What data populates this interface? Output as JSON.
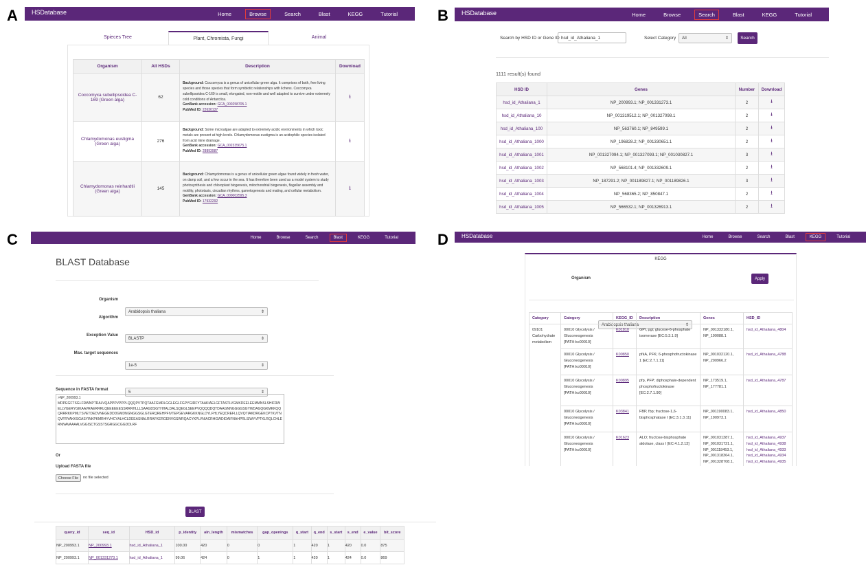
{
  "brand": "HSDatabase",
  "nav": [
    "Home",
    "Browse",
    "Search",
    "Blast",
    "KEGG",
    "Tutorial"
  ],
  "panels": {
    "a": "A",
    "b": "B",
    "c": "C",
    "d": "D"
  },
  "browse": {
    "tabs": [
      "Spieces Tree",
      "Plant, Chromista, Fungi",
      "Animal"
    ],
    "headers": [
      "Organism",
      "All HSDs",
      "Description",
      "Download"
    ],
    "labels": {
      "bg": "Background:",
      "gb": "GenBank accession:",
      "pm": "PubMed ID:"
    },
    "rows": [
      {
        "org": "Coccomyxa subellipsoidea C-169 (Green alga)",
        "n": "62",
        "bg": "Coccomyxa is a genus of unicellular green alga. It comprises of both, free living species and those species that form symbiotic relationships with lichens. Coccomyxa subellipsoidea C-169 is small, elongated, non-motile and well adapted to survive under extremely cold conditions of Antarctica.",
        "gb": "GCA_000258705.1",
        "pm": "22630137"
      },
      {
        "org": "Chlamydomonas eustigma (Green alga)",
        "n": "276",
        "bg": "Some microalgae are adapted to extremely acidic environments in which toxic metals are present at high levels. Chlamydomonas eustigma is an acidophilic species isolated from acid mine drainage.",
        "gb": "GCA_002335675.1",
        "pm": "28893987"
      },
      {
        "org": "Chlamydomonas reinhardtii (Green alga)",
        "n": "145",
        "bg": "Chlamydomonas is a genus of unicellular green algae found widely in fresh water, on damp soil, and a few occur in the sea. It has therefore been used as a model system to study photosynthesis and chloroplast biogenesis, mitochondrial biogenesis, flagellar assembly and motility, phototaxis, circadian rhythms, gametogenesis and mating, and cellular metabolism.",
        "gb": "GCA_000002595.3",
        "pm": "17932292"
      }
    ]
  },
  "search": {
    "label": "Search by HSD ID or Gene ID",
    "value": "hsd_id_Athaliana_1",
    "cat_label": "Select Category",
    "cat_value": "All",
    "button": "Search",
    "count": "1111 result(s) found",
    "headers": [
      "HSD ID",
      "Genes",
      "Number",
      "Download"
    ],
    "rows": [
      {
        "id": "hsd_id_Athaliana_1",
        "genes": "NP_200993.1; NP_001331273.1",
        "n": "2"
      },
      {
        "id": "hsd_id_Athaliana_10",
        "genes": "NP_001319512.1; NP_001327098.1",
        "n": "2"
      },
      {
        "id": "hsd_id_Athaliana_100",
        "genes": "NP_563760.1; NP_849599.1",
        "n": "2"
      },
      {
        "id": "hsd_id_Athaliana_1000",
        "genes": "NP_196828.2; NP_001330651.1",
        "n": "2"
      },
      {
        "id": "hsd_id_Athaliana_1001",
        "genes": "NP_001327094.1; NP_001327093.1; NP_001030827.1",
        "n": "3"
      },
      {
        "id": "hsd_id_Athaliana_1002",
        "genes": "NP_568101.4; NP_001332609.1",
        "n": "2"
      },
      {
        "id": "hsd_id_Athaliana_1003",
        "genes": "NP_187291.2; NP_001189827.1; NP_001189826.1",
        "n": "3"
      },
      {
        "id": "hsd_id_Athaliana_1004",
        "genes": "NP_568365.2; NP_850847.1",
        "n": "2"
      },
      {
        "id": "hsd_id_Athaliana_1005",
        "genes": "NP_566532.1; NP_001326913.1",
        "n": "2"
      }
    ]
  },
  "blast": {
    "title": "BLAST Database",
    "fields": [
      {
        "label": "Organism",
        "value": "Arabidopsis thaliana"
      },
      {
        "label": "Algorithm",
        "value": "BLASTP"
      },
      {
        "label": "Exception Value",
        "value": "1e-5"
      },
      {
        "label": "Max. target sequences",
        "value": "5"
      }
    ],
    "fasta_label": "Sequence in FASTA format",
    "fasta": ">NP_200993.1\nMDPEGFTSGLFRWNPTRALVQAPPPVPPPLQQQPVTPQTAAFGMRLGGLEGLFGPYGIRFYTAAKIAELGFTASTLVGMKDEELEEMMNSLSHIFRWELLVGERYGIKAAVRAERRRLQEEEEEESSRRRHLLLSAAGDSGTHHALDALSQEGLSEEPVQQQQDQTDAAGNNGGGGSGYWDAGQGKMKKQQQRRRKKPMLTSVETDEDVNEGEDDDGMDNGNGGSGLGTERQREHPFIVTEPGEVARGKKNGLDYLFHLYEQCREFLLQVQTIAKDRGEKCPTKVTNQVFRYAKKSGASYINKPKMRHYVHCYALHCLDEEASNALRRAFKERGENVGSWRQACYKPLVNIACRHGWDIDAIFNAHPRLSIWYVPTKLRQLCHLERNNAVAAAALVGGISCTGSSTSGRGGCGGDDLRF",
    "or": "Or",
    "upload": "Upload FASTA file",
    "choose": "Choose File",
    "nofile": "no file selected",
    "button": "BLAST",
    "headers": [
      "query_id",
      "seq_id",
      "HSD_id",
      "p_identity",
      "aln_length",
      "mismatches",
      "gap_openings",
      "q_start",
      "q_end",
      "s_start",
      "s_end",
      "e_value",
      "bit_score"
    ],
    "rows": [
      [
        "NP_200993.1",
        "NP_200993.1",
        "hsd_id_Athaliana_1",
        "100.00",
        "420",
        "0",
        "0",
        "1",
        "420",
        "1",
        "420",
        "0.0",
        "875"
      ],
      [
        "NP_200993.1",
        "NP_001331273.1",
        "hsd_id_Athaliana_1",
        "99.06",
        "424",
        "0",
        "1",
        "1",
        "420",
        "1",
        "424",
        "0.0",
        "869"
      ]
    ]
  },
  "kegg": {
    "tab": "KEGG",
    "org_label": "Organism",
    "org_value": "Arabidopsis thaliana",
    "button": "Apply",
    "headers": [
      "Category",
      "Category",
      "KEGG_ID",
      "Description",
      "Genes",
      "HSD_ID"
    ],
    "category": "09101 Carbohydrate metabolism",
    "rows": [
      {
        "cat": "00010 Glycolysis / Gluconeogenesis [PATH:ko00010]",
        "id": "K01810",
        "desc": "GPI, pgi; glucose-6-phosphate isomerase [EC:5.3.1.9]",
        "genes": "NP_001332180.1, NP_199088.1",
        "hsd": [
          "hsd_id_Athaliana_4804"
        ]
      },
      {
        "cat": "00010 Glycolysis / Gluconeogenesis [PATH:ko00010]",
        "id": "K00850",
        "desc": "pfkA, PFK; 6-phosphofructokinase 1 [EC:2.7.1.11]",
        "genes": "NP_001032120.1, NP_200966.2",
        "hsd": [
          "hsd_id_Athaliana_4788"
        ]
      },
      {
        "cat": "00010 Glycolysis / Gluconeogenesis [PATH:ko00010]",
        "id": "K00895",
        "desc": "pfp, PFP; diphosphate-dependent phosphofructokinase [EC:2.7.1.90]",
        "genes": "NP_173519.1, NP_177781.1",
        "hsd": [
          "hsd_id_Athaliana_4787"
        ]
      },
      {
        "cat": "00010 Glycolysis / Gluconeogenesis [PATH:ko00010]",
        "id": "K03841",
        "desc": "FBP, fbp; fructose-1,6-bisphosphatase I [EC:3.1.3.11]",
        "genes": "NP_001190083.1, NP_190973.1",
        "hsd": [
          "hsd_id_Athaliana_4850"
        ]
      },
      {
        "cat": "00010 Glycolysis / Gluconeogenesis [PATH:ko00010]",
        "id": "K01623",
        "desc": "ALO; fructose-bisphosphate aldolase, class I [EC:4.1.2.13]",
        "genes": "NP_001031387.1, NP_001031721.1, NP_001118453.1, NP_001318364.1, NP_001328708.1,",
        "hsd": [
          "hsd_id_Athaliana_4937",
          "hsd_id_Athaliana_4938",
          "hsd_id_Athaliana_4933",
          "hsd_id_Athaliana_4934",
          "hsd_id_Athaliana_4935"
        ]
      }
    ]
  },
  "colors": {
    "brand": "#5b2779",
    "highlight": "#e23b3b"
  }
}
